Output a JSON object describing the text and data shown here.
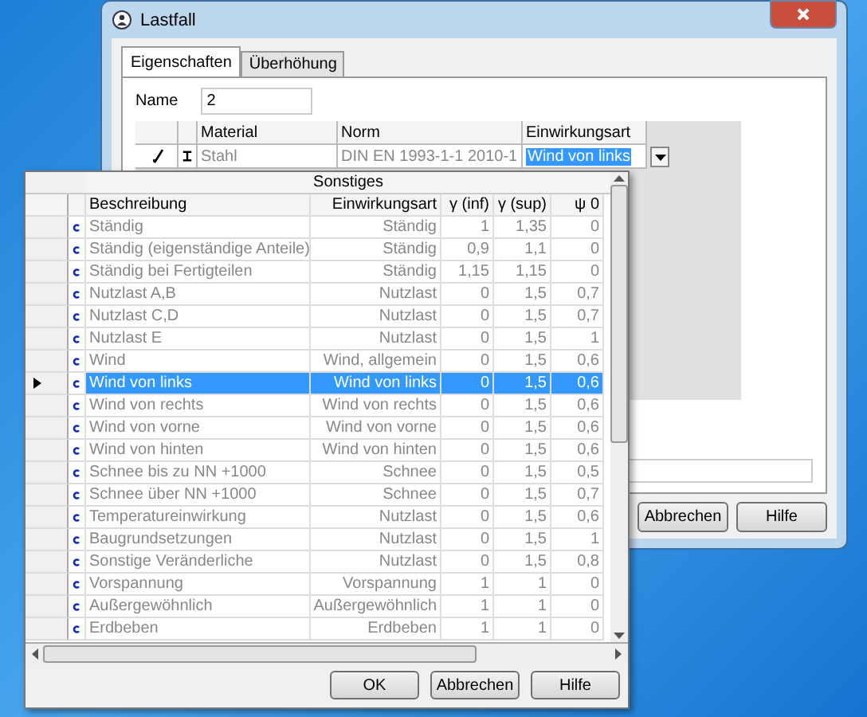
{
  "window": {
    "title": "Lastfall"
  },
  "tabs": [
    {
      "label": "Eigenschaften",
      "selected": true
    },
    {
      "label": "Überhöhung",
      "selected": false
    }
  ],
  "name_field": {
    "label": "Name",
    "value": "2"
  },
  "grid": {
    "columns": [
      "Material",
      "Norm",
      "Einwirkungsart"
    ],
    "rows": [
      {
        "material": "Stahl",
        "norm": "DIN EN 1993-1-1 2010-1",
        "einwirkungsart": "Wind von links"
      }
    ]
  },
  "buttons": [
    "Abbrechen",
    "Hilfe"
  ],
  "dropdown": {
    "group_header": "Sonstiges",
    "columns": [
      "Beschreibung",
      "Einwirkungsart",
      "γ (inf)",
      "γ (sup)",
      "ψ 0"
    ],
    "rows": [
      {
        "cells": [
          "Ständig",
          "Ständig",
          "1",
          "1,35",
          "0"
        ],
        "selected": false
      },
      {
        "cells": [
          "Ständig (eigenständige Anteile)",
          "Ständig",
          "0,9",
          "1,1",
          "0"
        ],
        "selected": false
      },
      {
        "cells": [
          "Ständig bei Fertigteilen",
          "Ständig",
          "1,15",
          "1,15",
          "0"
        ],
        "selected": false
      },
      {
        "cells": [
          "Nutzlast A,B",
          "Nutzlast",
          "0",
          "1,5",
          "0,7"
        ],
        "selected": false
      },
      {
        "cells": [
          "Nutzlast C,D",
          "Nutzlast",
          "0",
          "1,5",
          "0,7"
        ],
        "selected": false
      },
      {
        "cells": [
          "Nutzlast E",
          "Nutzlast",
          "0",
          "1,5",
          "1"
        ],
        "selected": false
      },
      {
        "cells": [
          "Wind",
          "Wind, allgemein",
          "0",
          "1,5",
          "0,6"
        ],
        "selected": false
      },
      {
        "cells": [
          "Wind von links",
          "Wind von links",
          "0",
          "1,5",
          "0,6"
        ],
        "selected": true
      },
      {
        "cells": [
          "Wind von rechts",
          "Wind von rechts",
          "0",
          "1,5",
          "0,6"
        ],
        "selected": false
      },
      {
        "cells": [
          "Wind von vorne",
          "Wind von vorne",
          "0",
          "1,5",
          "0,6"
        ],
        "selected": false
      },
      {
        "cells": [
          "Wind von hinten",
          "Wind von hinten",
          "0",
          "1,5",
          "0,6"
        ],
        "selected": false
      },
      {
        "cells": [
          "Schnee bis zu NN +1000",
          "Schnee",
          "0",
          "1,5",
          "0,5"
        ],
        "selected": false
      },
      {
        "cells": [
          "Schnee über NN +1000",
          "Schnee",
          "0",
          "1,5",
          "0,7"
        ],
        "selected": false
      },
      {
        "cells": [
          "Temperatureinwirkung",
          "Nutzlast",
          "0",
          "1,5",
          "0,6"
        ],
        "selected": false
      },
      {
        "cells": [
          "Baugrundsetzungen",
          "Nutzlast",
          "0",
          "1,5",
          "1"
        ],
        "selected": false
      },
      {
        "cells": [
          "Sonstige Veränderliche",
          "Nutzlast",
          "0",
          "1,5",
          "0,8"
        ],
        "selected": false
      },
      {
        "cells": [
          "Vorspannung",
          "Vorspannung",
          "1",
          "1",
          "0"
        ],
        "selected": false
      },
      {
        "cells": [
          "Außergewöhnlich",
          "Außergewöhnlich",
          "1",
          "1",
          "0"
        ],
        "selected": false
      },
      {
        "cells": [
          "Erdbeben",
          "Erdbeben",
          "1",
          "1",
          "0"
        ],
        "selected": false
      }
    ],
    "buttons": [
      "OK",
      "Abbrechen",
      "Hilfe"
    ]
  }
}
